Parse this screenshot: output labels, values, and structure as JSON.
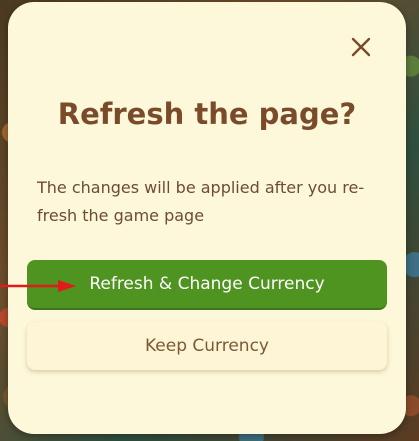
{
  "dialog": {
    "title": "Refresh the page?",
    "message": "The changes will be applied after you re-fresh the game page",
    "primary_button": "Refresh & Change Currency",
    "secondary_button": "Keep Currency",
    "close_icon": "close-icon"
  },
  "colors": {
    "modal_background": "#fdf8d9",
    "title": "#7a4b2a",
    "primary_button": "#4f9320",
    "annotation_arrow": "#e01b1b"
  }
}
